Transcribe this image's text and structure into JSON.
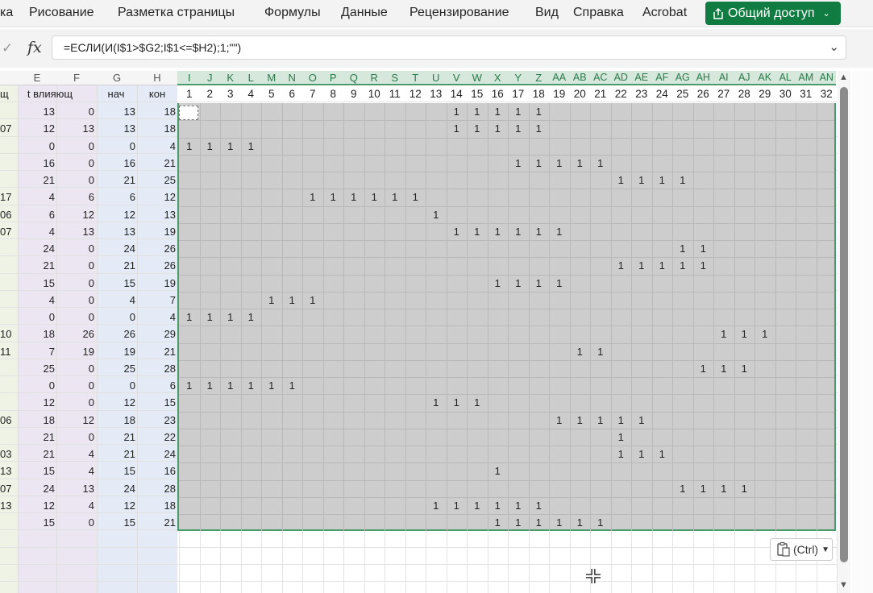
{
  "ribbon": {
    "items": [
      "ка",
      "Рисование",
      "Разметка страницы",
      "Формулы",
      "Данные",
      "Рецензирование",
      "Вид",
      "Справка",
      "Acrobat"
    ],
    "share_label": "Общий доступ",
    "share_color": "#107c41"
  },
  "formula_bar": {
    "cancel_glyph": "✓",
    "fx_label": "fx",
    "formula": "=ЕСЛИ(И(I$1>$G2;I$1<=$H2);1;\"\")",
    "expand_glyph": "⌄"
  },
  "grid": {
    "left_columns": [
      "E",
      "F",
      "G",
      "H"
    ],
    "header_row_labels": [
      "щ",
      "t влияющ",
      "нач",
      "кон"
    ],
    "timeline_letters": [
      "I",
      "J",
      "K",
      "L",
      "M",
      "N",
      "O",
      "P",
      "Q",
      "R",
      "S",
      "T",
      "U",
      "V",
      "W",
      "X",
      "Y",
      "Z",
      "AA",
      "AB",
      "AC",
      "AD",
      "AE",
      "AF",
      "AG",
      "AH",
      "AI",
      "AJ",
      "AK",
      "AL",
      "AM",
      "AN"
    ],
    "timeline_numbers": [
      1,
      2,
      3,
      4,
      5,
      6,
      7,
      8,
      9,
      10,
      11,
      12,
      13,
      14,
      15,
      16,
      17,
      18,
      19,
      20,
      21,
      22,
      23,
      24,
      25,
      26,
      27,
      28,
      29,
      30,
      31,
      32
    ],
    "rows": [
      {
        "d": "",
        "e": 13,
        "f": 0,
        "g": 13,
        "h": 18,
        "s": 14,
        "n": 5
      },
      {
        "d": "07",
        "e": 12,
        "f": 13,
        "g": 13,
        "h": 18,
        "s": 14,
        "n": 5
      },
      {
        "d": "",
        "e": 0,
        "f": 0,
        "g": 0,
        "h": 4,
        "s": 1,
        "n": 4
      },
      {
        "d": "",
        "e": 16,
        "f": 0,
        "g": 16,
        "h": 21,
        "s": 17,
        "n": 5
      },
      {
        "d": "",
        "e": 21,
        "f": 0,
        "g": 21,
        "h": 25,
        "s": 22,
        "n": 4
      },
      {
        "d": "17",
        "e": 4,
        "f": 6,
        "g": 6,
        "h": 12,
        "s": 7,
        "n": 6
      },
      {
        "d": "06",
        "e": 6,
        "f": 12,
        "g": 12,
        "h": 13,
        "s": 13,
        "n": 1
      },
      {
        "d": "07",
        "e": 4,
        "f": 13,
        "g": 13,
        "h": 19,
        "s": 14,
        "n": 6
      },
      {
        "d": "",
        "e": 24,
        "f": 0,
        "g": 24,
        "h": 26,
        "s": 25,
        "n": 2
      },
      {
        "d": "",
        "e": 21,
        "f": 0,
        "g": 21,
        "h": 26,
        "s": 22,
        "n": 5
      },
      {
        "d": "",
        "e": 15,
        "f": 0,
        "g": 15,
        "h": 19,
        "s": 16,
        "n": 4
      },
      {
        "d": "",
        "e": 4,
        "f": 0,
        "g": 4,
        "h": 7,
        "s": 5,
        "n": 3
      },
      {
        "d": "",
        "e": 0,
        "f": 0,
        "g": 0,
        "h": 4,
        "s": 1,
        "n": 4
      },
      {
        "d": "10",
        "e": 18,
        "f": 26,
        "g": 26,
        "h": 29,
        "s": 27,
        "n": 3
      },
      {
        "d": "11",
        "e": 7,
        "f": 19,
        "g": 19,
        "h": 21,
        "s": 20,
        "n": 2
      },
      {
        "d": "",
        "e": 25,
        "f": 0,
        "g": 25,
        "h": 28,
        "s": 26,
        "n": 3
      },
      {
        "d": "",
        "e": 0,
        "f": 0,
        "g": 0,
        "h": 6,
        "s": 1,
        "n": 6
      },
      {
        "d": "",
        "e": 12,
        "f": 0,
        "g": 12,
        "h": 15,
        "s": 13,
        "n": 3
      },
      {
        "d": "06",
        "e": 18,
        "f": 12,
        "g": 18,
        "h": 23,
        "s": 19,
        "n": 5
      },
      {
        "d": "",
        "e": 21,
        "f": 0,
        "g": 21,
        "h": 22,
        "s": 22,
        "n": 1
      },
      {
        "d": "03",
        "e": 21,
        "f": 4,
        "g": 21,
        "h": 24,
        "s": 22,
        "n": 3
      },
      {
        "d": "13",
        "e": 15,
        "f": 4,
        "g": 15,
        "h": 16,
        "s": 16,
        "n": 1
      },
      {
        "d": "07",
        "e": 24,
        "f": 13,
        "g": 24,
        "h": 28,
        "s": 25,
        "n": 4
      },
      {
        "d": "13",
        "e": 12,
        "f": 4,
        "g": 12,
        "h": 18,
        "s": 13,
        "n": 6
      },
      {
        "d": "",
        "e": 15,
        "f": 0,
        "g": 15,
        "h": 21,
        "s": 16,
        "n": 6
      }
    ],
    "marker": "1"
  },
  "paste_options": {
    "label": "(Ctrl)"
  }
}
